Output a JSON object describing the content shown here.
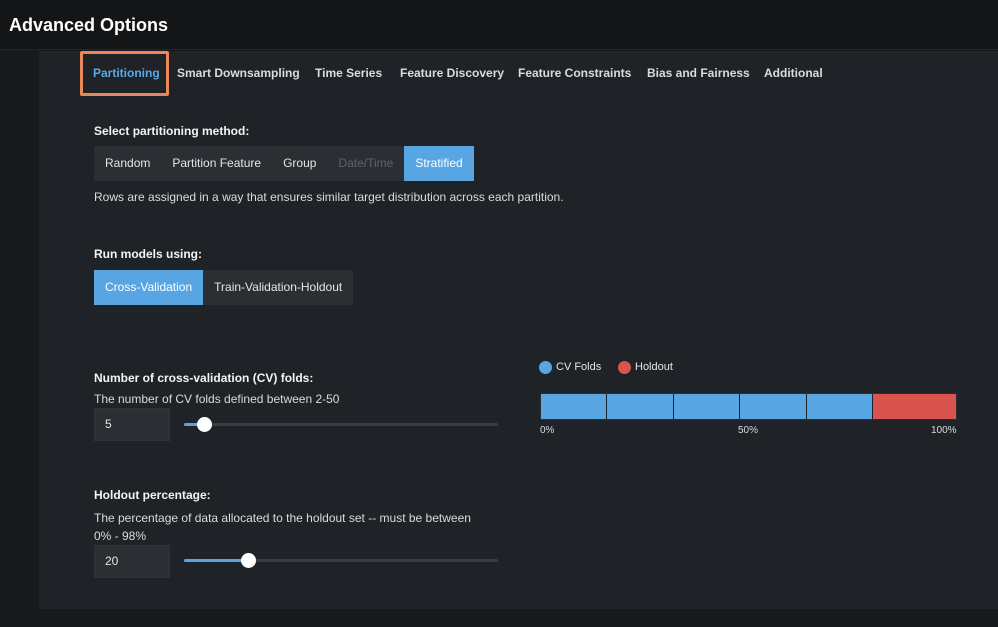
{
  "header": {
    "title": "Advanced Options"
  },
  "tabs": [
    {
      "label": "Partitioning",
      "active": true
    },
    {
      "label": "Smart Downsampling"
    },
    {
      "label": "Time Series"
    },
    {
      "label": "Feature Discovery"
    },
    {
      "label": "Feature Constraints"
    },
    {
      "label": "Bias and Fairness"
    },
    {
      "label": "Additional"
    }
  ],
  "partitioning": {
    "label": "Select partitioning method:",
    "methods": [
      {
        "label": "Random"
      },
      {
        "label": "Partition Feature"
      },
      {
        "label": "Group"
      },
      {
        "label": "Date/Time",
        "disabled": true
      },
      {
        "label": "Stratified",
        "selected": true
      }
    ],
    "description": "Rows are assigned in a way that ensures similar target distribution across each partition."
  },
  "run_models": {
    "label": "Run models using:",
    "options": [
      {
        "label": "Cross-Validation",
        "selected": true
      },
      {
        "label": "Train-Validation-Holdout"
      }
    ]
  },
  "cv_folds": {
    "label": "Number of cross-validation (CV) folds:",
    "help": "The number of CV folds defined between 2-50",
    "value": "5",
    "min": 2,
    "max": 50
  },
  "holdout": {
    "label": "Holdout percentage:",
    "help_line1": "The percentage of data allocated to the holdout set -- must be between",
    "help_line2": "0% - 98%",
    "value": "20",
    "min": 0,
    "max": 98
  },
  "chart_data": {
    "type": "bar",
    "legend": [
      {
        "name": "CV Folds",
        "color": "#58a5e3"
      },
      {
        "name": "Holdout",
        "color": "#d9534f"
      }
    ],
    "cv_fold_count": 5,
    "holdout_percent": 20,
    "ticks": [
      "0%",
      "50%",
      "100%"
    ]
  },
  "colors": {
    "accent": "#58a5e3",
    "holdout": "#d9534f",
    "highlight": "#e9875a"
  }
}
